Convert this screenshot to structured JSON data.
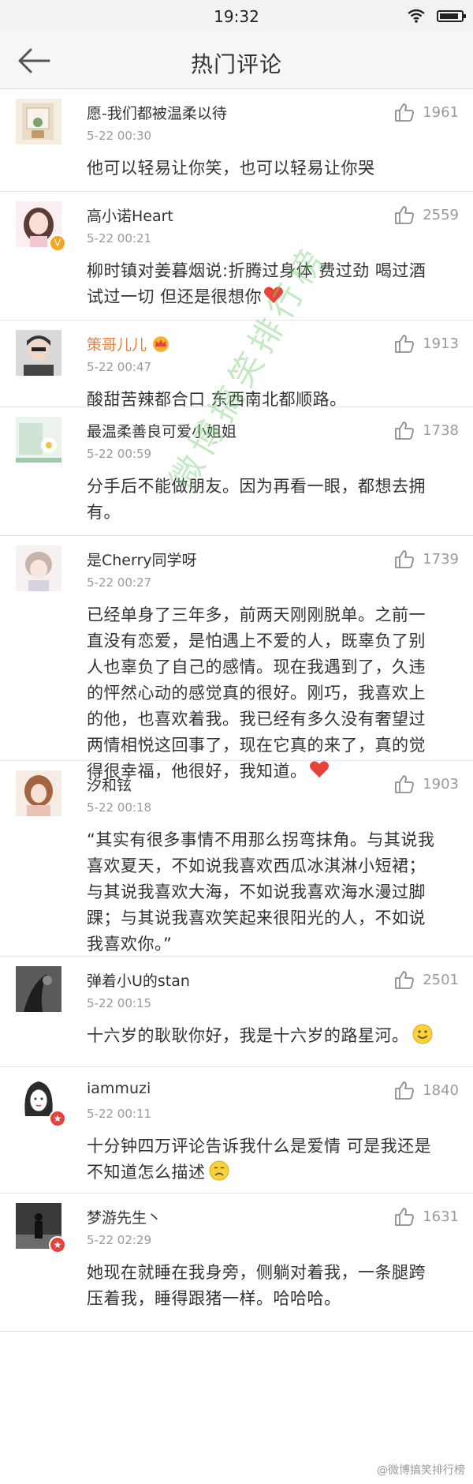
{
  "status_bar": {
    "time": "19:32",
    "battery_level": 0.9
  },
  "nav": {
    "title": "热门评论",
    "back_icon": "arrow-left-icon"
  },
  "watermark": "微博搞笑排行榜",
  "source_mark": "@微博搞笑排行榜",
  "comments": [
    {
      "name": "愿-我们都被温柔以待",
      "time": "5-22 00:30",
      "likes": "1961",
      "text": "他可以轻易让你笑，也可以轻易让你哭"
    },
    {
      "name": "高小诺Heart",
      "time": "5-22 00:21",
      "likes": "2559",
      "text": "柳时镇对姜暮烟说:折腾过身体 费过劲 喝过酒 试过一切 但还是很想你",
      "badge": "V"
    },
    {
      "name": "策哥儿儿",
      "time": "5-22 00:47",
      "likes": "1913",
      "text": "酸甜苦辣都合口 东西南北都顺路。"
    },
    {
      "name": "最温柔善良可爱小姐姐",
      "time": "5-22 00:59",
      "likes": "1738",
      "text": "分手后不能做朋友。因为再看一眼，都想去拥有。"
    },
    {
      "name": "是Cherry同学呀",
      "time": "5-22 00:27",
      "likes": "1739",
      "text": "已经单身了三年多，前两天刚刚脱单。之前一直没有恋爱，是怕遇上不爱的人，既辜负了别人也辜负了自己的感情。现在我遇到了，久违的怦然心动的感觉真的很好。刚巧，我喜欢上的他，也喜欢着我。我已经有多久没有奢望过两情相悦这回事了，现在它真的来了，真的觉得很幸福，他很好，我知道。"
    },
    {
      "name": "汐和铉",
      "time": "5-22 00:18",
      "likes": "1903",
      "text": "“其实有很多事情不用那么拐弯抹角。与其说我喜欢夏天，不如说我喜欢西瓜冰淇淋小短裙；与其说我喜欢大海，不如说我喜欢海水漫过脚踝；与其说我喜欢笑起来很阳光的人，不如说我喜欢你。”"
    },
    {
      "name": "弹着小U的stan",
      "time": "5-22 00:15",
      "likes": "2501",
      "text": "十六岁的耿耿你好，我是十六岁的路星河。"
    },
    {
      "name": "iammuzi",
      "time": "5-22 00:11",
      "likes": "1840",
      "text": "十分钟四万评论告诉我什么是爱情 可是我还是不知道怎么描述"
    },
    {
      "name": "梦游先生丶",
      "time": "5-22 02:29",
      "likes": "1631",
      "text": "她现在就睡在我身旁，侧躺对着我，一条腿跨压着我，睡得跟猪一样。哈哈哈。"
    }
  ],
  "colors": {
    "vip_name": "#e9803a",
    "heart": "#e8433a",
    "verified": "#f5a623",
    "watermark": "#7ccf7a"
  }
}
